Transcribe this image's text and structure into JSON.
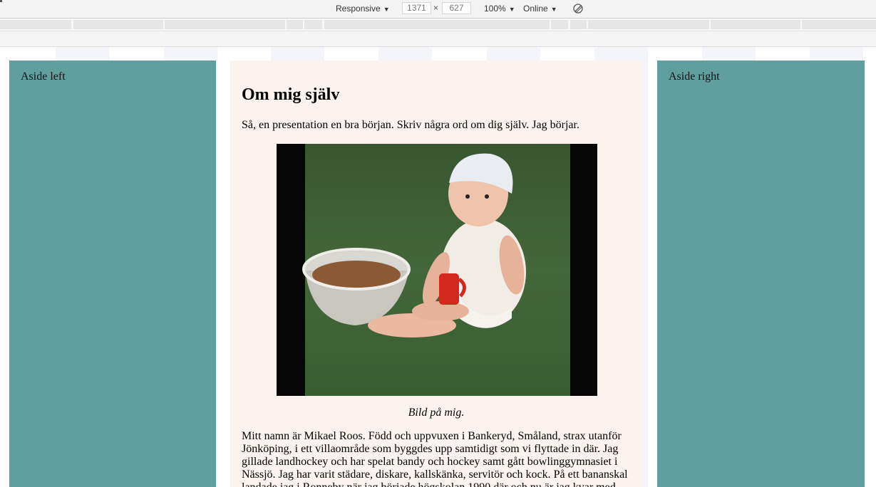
{
  "devtools": {
    "device": "Responsive",
    "width": "1371",
    "height": "627",
    "times": "×",
    "zoom": "100%",
    "network": "Online"
  },
  "page": {
    "aside_left": "Aside left",
    "aside_right": "Aside right",
    "main": {
      "title": "Om mig själv",
      "intro": "Så, en presentation en bra början. Skriv några ord om dig själv. Jag börjar.",
      "image_caption": "Bild på mig.",
      "body": "Mitt namn är Mikael Roos. Född och uppvuxen i Bankeryd, Småland, strax utanför Jönköping, i ett villaområde som byggdes upp samtidigt som vi flyttade in där. Jag gillade landhockey och har spelat bandy och hockey samt gått bowlinggymnasiet i Nässjö. Jag har varit städare, diskare, kallskänka, servitör och kock. På ett bananskal landade jag i Ronneby när jag började högskolan 1990 där och nu är jag kvar med"
    }
  },
  "colors": {
    "aside_bg": "#609fa0",
    "main_bg": "#fdf3ee"
  }
}
